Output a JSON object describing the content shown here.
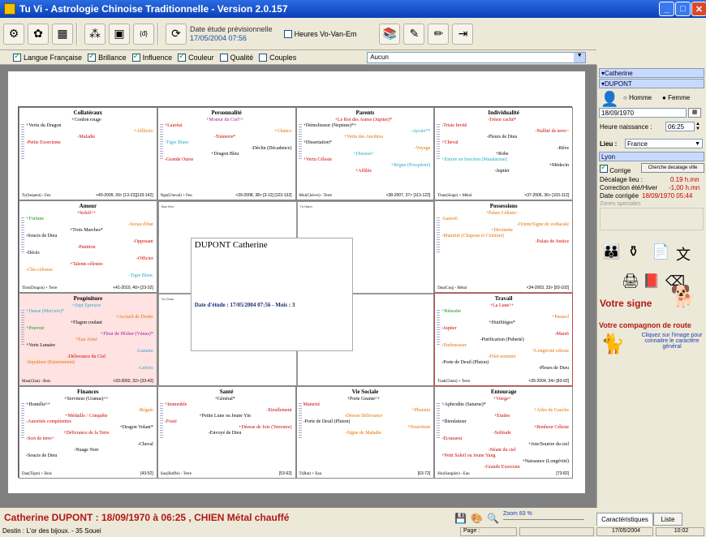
{
  "window": {
    "title": "Tu Vi - Astrologie Chinoise Traditionnelle - Version 2.0.157"
  },
  "toolbar": {
    "date_label": "Date étude prévisionnelle",
    "date_value": "17/05/2004 07:56",
    "vovan_label": "Heures Vo-Van-Em"
  },
  "options": {
    "items": [
      "Langue Française",
      "Brillance",
      "Influence",
      "Couleur",
      "Qualité",
      "Couples"
    ],
    "checked": [
      true,
      true,
      true,
      true,
      false,
      false
    ],
    "dropdown": "Aucun"
  },
  "palaces": [
    {
      "title": "Collatéraux",
      "lines": [
        [
          "+Cordon rouge",
          "blk"
        ],
        [
          "+Vertu du Dragon",
          "blk"
        ],
        [
          "+Afflictio",
          "org"
        ],
        [
          "-Maladie",
          "red"
        ],
        [
          "-Petite Exorcisme",
          "red"
        ]
      ],
      "foot": "Ty(Serpent) - Feu",
      "range": "<40-2009, 39> [13-22][133-142]"
    },
    {
      "title": "Personnalité",
      "lines": [
        [
          "+Moteur du Ciel^+",
          "pur"
        ],
        [
          "+Lauréat",
          "red"
        ],
        [
          "+Chance",
          "org"
        ],
        [
          "-Tonnerre*",
          "red"
        ],
        [
          "-Tigre Blanc",
          "cya"
        ],
        [
          "-Déclin (Décadence)",
          "blk"
        ],
        [
          "+Dragon Bleu",
          "blk"
        ],
        [
          "-Grande Ourse",
          "red"
        ]
      ],
      "foot": "Ngo(Cheval) + Feu",
      "range": "<39-2008, 38> [3-12] [123-132]"
    },
    {
      "title": "Parents",
      "lines": [
        [
          "+Le Roi des Astres (Jupiter)*",
          "red"
        ],
        [
          "+Démolisseur (Neptune)*+",
          "blk"
        ],
        [
          "-Ayraie**",
          "cya"
        ],
        [
          "+Vertu des Ancêtres",
          "org"
        ],
        [
          "+Dissertation*",
          "blk"
        ],
        [
          "-Voyage",
          "org"
        ],
        [
          "+Diseuse^",
          "cya"
        ],
        [
          "+Vertu Céleste",
          "red"
        ],
        [
          "+Règne (Prospérité)",
          "cya"
        ],
        [
          "+Affilée",
          "red"
        ]
      ],
      "foot": "Mui(Chèvre) - Terre",
      "range": "<38-2007, 37> [113-122]"
    },
    {
      "title": "Individualité",
      "lines": [
        [
          "-Trésor caché*",
          "red"
        ],
        [
          "-Triste Invité",
          "red"
        ],
        [
          "-Nullité de terre~",
          "red"
        ],
        [
          "-Pleurs de Dieu",
          "blk"
        ],
        [
          "+Cheval",
          "red"
        ],
        [
          "-Rêve",
          "blk"
        ],
        [
          "+Robe",
          "blk"
        ],
        [
          "+Entrée en fonction (Mandarinat)",
          "cya"
        ],
        [
          "+Médecin",
          "blk"
        ],
        [
          "-Jupiter",
          "blk"
        ]
      ],
      "foot": "Than(Singe) + Métal",
      "range": "<37-2006, 36> [103-112]"
    },
    {
      "title": "Amour",
      "lines": [
        [
          "+Soleil^+",
          "red"
        ],
        [
          "+Fortune",
          "grn"
        ],
        [
          "-Sceau d'état",
          "org"
        ],
        [
          "+Trois Marches*",
          "blk"
        ],
        [
          "-Soucis de Dieu",
          "blk"
        ],
        [
          "-Opposant",
          "red"
        ],
        [
          "-Punition",
          "red"
        ],
        [
          "-Décès",
          "blk"
        ],
        [
          "-Officier",
          "red"
        ],
        [
          "+Talents célestes",
          "red"
        ],
        [
          "-Clés célestes",
          "org"
        ],
        [
          "-Tigre Blanc",
          "cya"
        ]
      ],
      "foot": "Thin(Dragon) + Terre",
      "range": "<41-2010, 40> [23-32]"
    },
    {
      "title": "Possessions",
      "lines": [
        [
          "+Palais Céleste~",
          "org"
        ],
        [
          "-Lance6",
          "org"
        ],
        [
          "-Orient/Signe de zodiacale",
          "org"
        ],
        [
          "+Devinette",
          "org"
        ],
        [
          "-Maturité (Chapeau et Ceinture)",
          "org"
        ],
        [
          "-Palais de Justice",
          "red"
        ]
      ],
      "foot": "Dau(Coq) - Métal",
      "range": "<34-2003, 33> [93-102]"
    },
    {
      "title": "Progéniture",
      "lines": [
        [
          "+Sept Epreuve",
          "cya"
        ],
        [
          "+Danse (Mercure)*",
          "cya"
        ],
        [
          "+Accueil de Droite",
          "org"
        ],
        [
          "+Flagon coulant",
          "blk"
        ],
        [
          "+Pouvoir",
          "grn"
        ],
        [
          "+Fleur de Pêcher (Vénus)*",
          "pur"
        ],
        [
          "+Eau Aimé",
          "org"
        ],
        [
          "+Verts Lunaire",
          "blk"
        ],
        [
          "-Lunaire",
          "cya"
        ],
        [
          "-Délivrance du Ciel",
          "red"
        ],
        [
          "-Sépulture (Enterrement)",
          "org"
        ],
        [
          "-Lettres",
          "cya"
        ]
      ],
      "foot": "Mao(Chat) - Bois",
      "range": "<33-2002, 32> [33-42]"
    },
    {
      "title": "Travail",
      "lines": [
        [
          "+La Lune^+",
          "red"
        ],
        [
          "+Réussite",
          "grn"
        ],
        [
          "+Parasol",
          "org"
        ],
        [
          "+HuitSièges*",
          "blk"
        ],
        [
          "-Jupiter",
          "red"
        ],
        [
          "-Mars6",
          "red"
        ],
        [
          "-Purification (Puberté)",
          "blk"
        ],
        [
          "-Embrasseur",
          "org"
        ],
        [
          "+Longévité céleste",
          "org"
        ],
        [
          "-Filet terrestre",
          "org"
        ],
        [
          "-Porte de Deuil (Pluton)",
          "blk"
        ],
        [
          "-Pleurs de Dieu",
          "blk"
        ]
      ],
      "foot": "Tuat(Chien) + Terre",
      "range": "<35-2004, 34> [83-92]"
    },
    {
      "title": "Finances",
      "lines": [
        [
          "+Serviteur (Uranus)^+",
          "blk"
        ],
        [
          "+Homélie^+",
          "blk"
        ],
        [
          "-Régale",
          "org"
        ],
        [
          "+Médaille / Conquête",
          "red"
        ],
        [
          "-Autorités compétentes",
          "red"
        ],
        [
          "+Dragon Volant*",
          "blk"
        ],
        [
          "+Délivrance de la Terre",
          "red"
        ],
        [
          "-Sort de terre~",
          "red"
        ],
        [
          "-Cheval",
          "blk"
        ],
        [
          "-Nuage Noir",
          "blk"
        ],
        [
          "-Soucis de Dieu",
          "blk"
        ]
      ],
      "foot": "Dan(Tigre) + Bois",
      "range": "[43-52]"
    },
    {
      "title": "Santé",
      "lines": [
        [
          "+Général*",
          "blk"
        ],
        [
          "+Immeuble",
          "red"
        ],
        [
          "-Eteullement",
          "red"
        ],
        [
          "+Petite Lune ou Jeune Yin",
          "blk"
        ],
        [
          "-Fosté",
          "red"
        ],
        [
          "+Déesse de Joie (Terrestre)",
          "red"
        ],
        [
          "-Envoyé de Dieu",
          "blk"
        ]
      ],
      "foot": "Suu(Buffle) - Terre",
      "range": "[53-62]"
    },
    {
      "title": "Vie Sociale",
      "lines": [
        [
          "+Porte Geante^+",
          "blk"
        ],
        [
          "Maturité",
          "red"
        ],
        [
          "+Phoenix",
          "org"
        ],
        [
          "-Déesse Délivrance",
          "org"
        ],
        [
          "-Porte de Deuil (Pluton)",
          "blk"
        ],
        [
          "+Nourriture",
          "org"
        ],
        [
          "-Signe de Maladie",
          "org"
        ]
      ],
      "foot": "Ti(Rat) + Eau",
      "range": "[63-72]"
    },
    {
      "title": "Entourage",
      "lines": [
        [
          "+Vierge^",
          "red"
        ],
        [
          "+Aphrodite (Saturne)*",
          "blk"
        ],
        [
          "+Ailes de Gauche",
          "org"
        ],
        [
          "+Etudes",
          "red"
        ],
        [
          "+Bienfaiteur",
          "blk"
        ],
        [
          "+Bonheur Céleste",
          "red"
        ],
        [
          "-Solitude",
          "red"
        ],
        [
          "-Ecrasseur",
          "red"
        ],
        [
          "+Joie/Sourire du ciel",
          "blk"
        ],
        [
          "-Néant du ciel",
          "red"
        ],
        [
          "+Petit Soleil ou Jeune Yang",
          "red"
        ],
        [
          "+Naissance (Longévité)",
          "blk"
        ],
        [
          "-Grande Exorcism",
          "red"
        ]
      ],
      "foot": "Hoi(Sanglier) - Eau",
      "range": "[73-82]"
    }
  ],
  "center": {
    "name": "DUPONT Catherine",
    "date": "Date d'étude : 17/05/2004 07:56 - Mois : 3",
    "inner_tl": "Sao Kim",
    "inner_tr": "Tu Hanh",
    "inner_bl": "Tu Chau",
    "inner_br": "Tu Kinh"
  },
  "right": {
    "firstname": "Catherine",
    "lastname": "DUPONT",
    "gender_h": "Homme",
    "gender_f": "Femme",
    "birthdate": "18/09/1970",
    "hour_label": "Heure naissance :",
    "hour": "06:25",
    "lieu_label": "Lieu :",
    "country": "France",
    "city": "Lyon",
    "corrige_label": "Corrige",
    "cherche": "Cherche decalage ville",
    "decalage": "Décalage lieu :",
    "decalage_val": "0.19 h.mn",
    "correction": "Correction été/Hiver",
    "correction_val": "-1,00 h.mn",
    "corrigee": "Date corrigée",
    "corrigee_val": "18/09/1970 05:44",
    "zones": "Zones speciales",
    "votre_signe": "Votre signe",
    "compagnon": "Votre compagnon de route",
    "cliquez": "Cliquez sur l'image pour connaitre le caractère général"
  },
  "status": {
    "subject": "Catherine DUPONT : 18/09/1970 à 06:25 ,  CHIEN Métal chauffé",
    "destin": "Destin : L'or des bijoux. - 35 Souei",
    "zoom": "Zoom 83 %",
    "page": "Page :",
    "date": "17/05/2004",
    "time": "10:02",
    "tab1": "Caractéristiques",
    "tab2": "Liste"
  }
}
